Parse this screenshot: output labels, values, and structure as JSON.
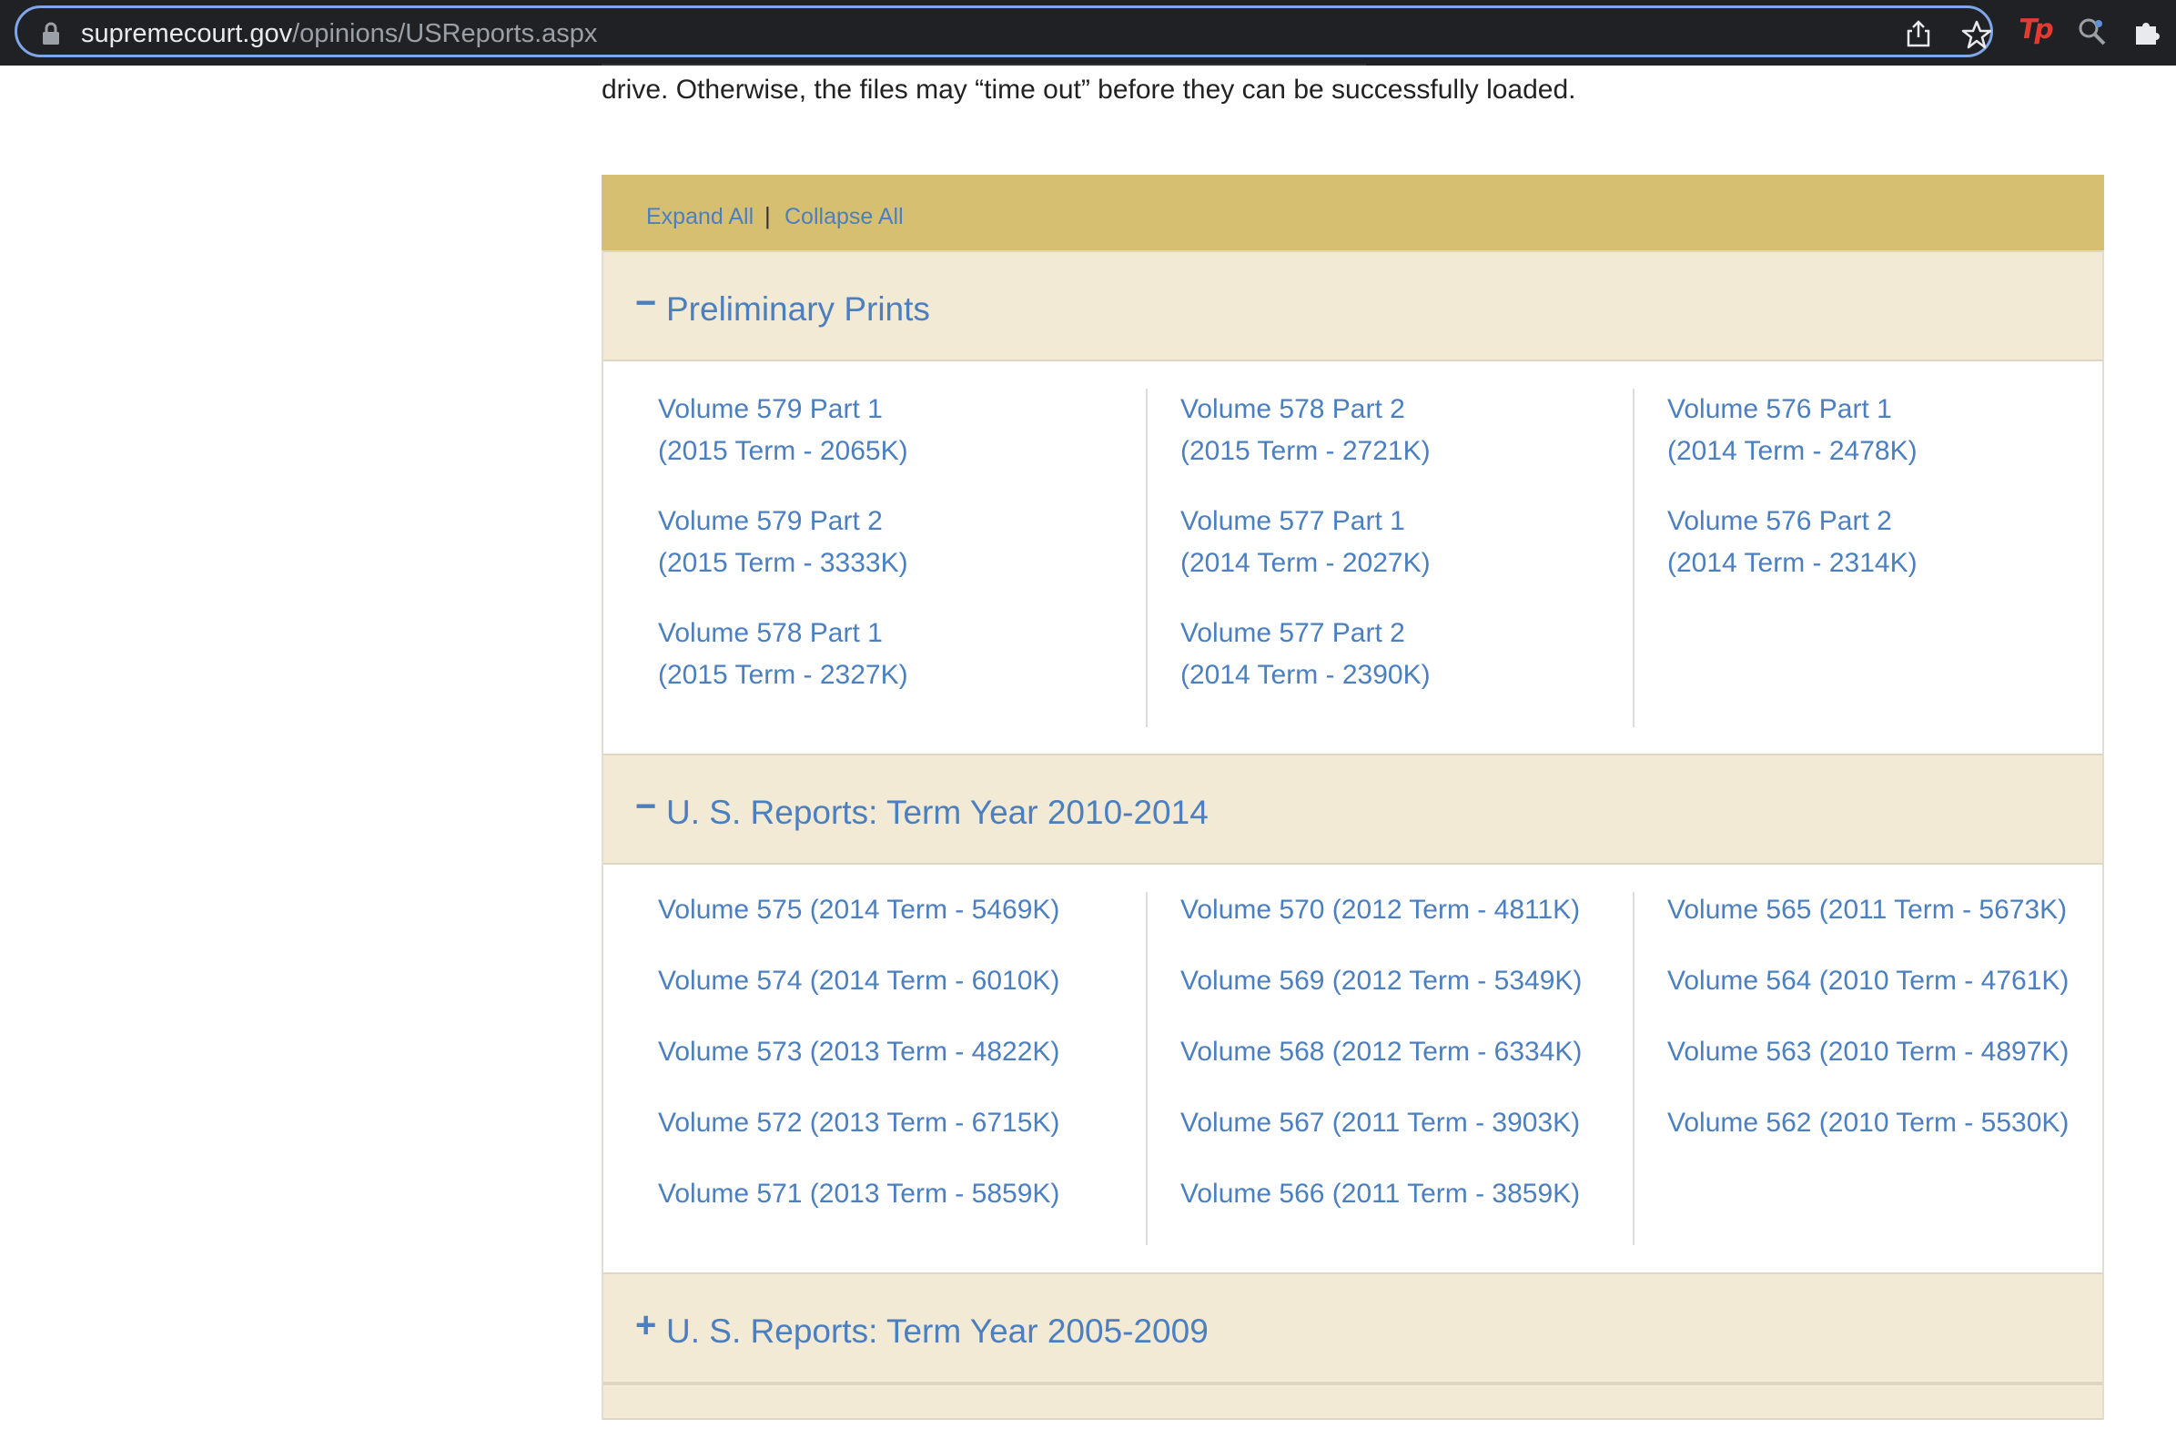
{
  "browser": {
    "url_domain": "supremecourt.gov",
    "url_path": "/opinions/USReports.aspx",
    "ext_tp_label": "Tp"
  },
  "intro": {
    "text": "drive. Otherwise, the files may “time out” before they can be successfully loaded."
  },
  "toolbar": {
    "expand_label": "Expand All",
    "separator": "|",
    "collapse_label": "Collapse All"
  },
  "sections": [
    {
      "title": "Preliminary Prints",
      "toggle": "−",
      "columns": [
        [
          {
            "line1": "Volume 579 Part 1",
            "line2": "(2015 Term - 2065K)"
          },
          {
            "line1": "Volume 579 Part 2",
            "line2": "(2015 Term - 3333K)"
          },
          {
            "line1": "Volume 578 Part 1",
            "line2": "(2015 Term - 2327K)"
          }
        ],
        [
          {
            "line1": "Volume 578 Part 2",
            "line2": "(2015 Term - 2721K)"
          },
          {
            "line1": "Volume 577 Part 1",
            "line2": "(2014 Term - 2027K)"
          },
          {
            "line1": "Volume 577 Part 2",
            "line2": "(2014 Term - 2390K)"
          }
        ],
        [
          {
            "line1": "Volume 576 Part 1",
            "line2": "(2014 Term - 2478K)"
          },
          {
            "line1": "Volume 576 Part 2",
            "line2": "(2014 Term - 2314K)"
          }
        ]
      ]
    },
    {
      "title": "U. S. Reports: Term Year 2010-2014",
      "toggle": "−",
      "columns": [
        [
          "Volume 575  (2014 Term - 5469K)",
          "Volume 574  (2014 Term - 6010K)",
          "Volume 573  (2013 Term - 4822K)",
          "Volume 572  (2013 Term - 6715K)",
          "Volume 571  (2013 Term - 5859K)"
        ],
        [
          "Volume 570  (2012 Term - 4811K)",
          "Volume 569  (2012 Term - 5349K)",
          "Volume 568  (2012 Term - 6334K)",
          "Volume 567  (2011 Term - 3903K)",
          "Volume 566  (2011 Term - 3859K)"
        ],
        [
          "Volume 565  (2011 Term - 5673K)",
          "Volume 564  (2010 Term - 4761K)",
          "Volume 563  (2010 Term - 4897K)",
          "Volume 562  (2010 Term - 5530K)"
        ]
      ]
    },
    {
      "title": "U. S. Reports: Term Year 2005-2009",
      "toggle": "+"
    }
  ],
  "colors": {
    "link": "#4b7fc0",
    "toolbar_bg": "#d7bf72",
    "section_head_bg": "#f2ead4",
    "browser_bg": "#202124",
    "omnibox_border": "#7fa6e6"
  }
}
